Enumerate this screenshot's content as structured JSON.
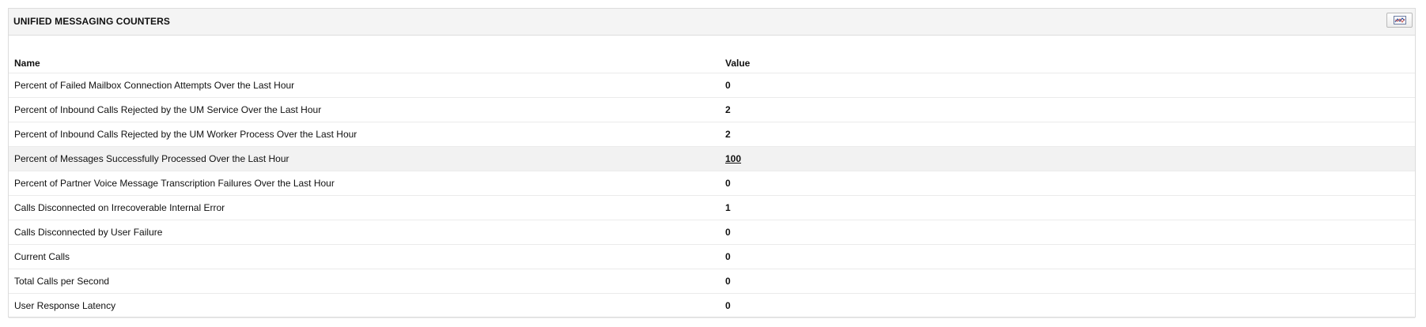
{
  "panel": {
    "title": "UNIFIED MESSAGING COUNTERS",
    "chart_button_icon": "chart-icon"
  },
  "table": {
    "columns": {
      "name": "Name",
      "value": "Value"
    },
    "rows": [
      {
        "name": "Percent of Failed Mailbox Connection Attempts Over the Last Hour",
        "value": "0"
      },
      {
        "name": "Percent of Inbound Calls Rejected by the UM Service Over the Last Hour",
        "value": "2"
      },
      {
        "name": "Percent of Inbound Calls Rejected by the UM Worker Process Over the Last Hour",
        "value": "2"
      },
      {
        "name": "Percent of Messages Successfully Processed Over the Last Hour",
        "value": "100"
      },
      {
        "name": "Percent of Partner Voice Message Transcription Failures Over the Last Hour",
        "value": "0"
      },
      {
        "name": "Calls Disconnected on Irrecoverable Internal Error",
        "value": "1"
      },
      {
        "name": "Calls Disconnected by User Failure",
        "value": "0"
      },
      {
        "name": "Current Calls",
        "value": "0"
      },
      {
        "name": "Total Calls per Second",
        "value": "0"
      },
      {
        "name": "User Response Latency",
        "value": "0"
      }
    ]
  }
}
